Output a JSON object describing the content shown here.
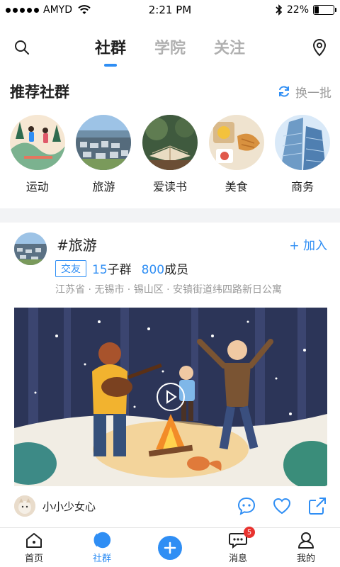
{
  "status_bar": {
    "carrier": "AMYD",
    "time": "2:21 PM",
    "battery_percent": "22%",
    "battery_level": 0.22,
    "icons": [
      "signal-icon",
      "wifi-icon",
      "bluetooth-icon",
      "battery-icon"
    ]
  },
  "top_nav": {
    "tabs": [
      {
        "label": "社群",
        "active": true
      },
      {
        "label": "学院",
        "active": false
      },
      {
        "label": "关注",
        "active": false
      }
    ],
    "left_icon": "search-icon",
    "right_icon": "location-pin-icon"
  },
  "recommend": {
    "title": "推荐社群",
    "refresh_label": "换一批",
    "items": [
      {
        "label": "运动"
      },
      {
        "label": "旅游"
      },
      {
        "label": "爱读书"
      },
      {
        "label": "美食"
      },
      {
        "label": "商务"
      }
    ]
  },
  "card": {
    "title": "#旅游",
    "join_label": "+ 加入",
    "tag": "交友",
    "sub_groups_num": "15",
    "sub_groups_label": "子群",
    "members_num": "800",
    "members_label": "成员",
    "address": "江苏省 · 无锡市 · 锡山区 · 安镇街道纬四路新日公寓",
    "user_name": "小小少女心"
  },
  "bottom_nav": {
    "items": [
      {
        "label": "首页",
        "icon": "home-icon",
        "active": false
      },
      {
        "label": "社群",
        "icon": "community-icon",
        "active": true
      },
      {
        "label": "",
        "icon": "plus-icon",
        "active": false
      },
      {
        "label": "消息",
        "icon": "message-icon",
        "active": false,
        "badge": "5"
      },
      {
        "label": "我的",
        "icon": "profile-icon",
        "active": false
      }
    ]
  },
  "colors": {
    "accent": "#2f8ef4",
    "badge": "#e8322f",
    "muted": "#9a9a9a"
  }
}
